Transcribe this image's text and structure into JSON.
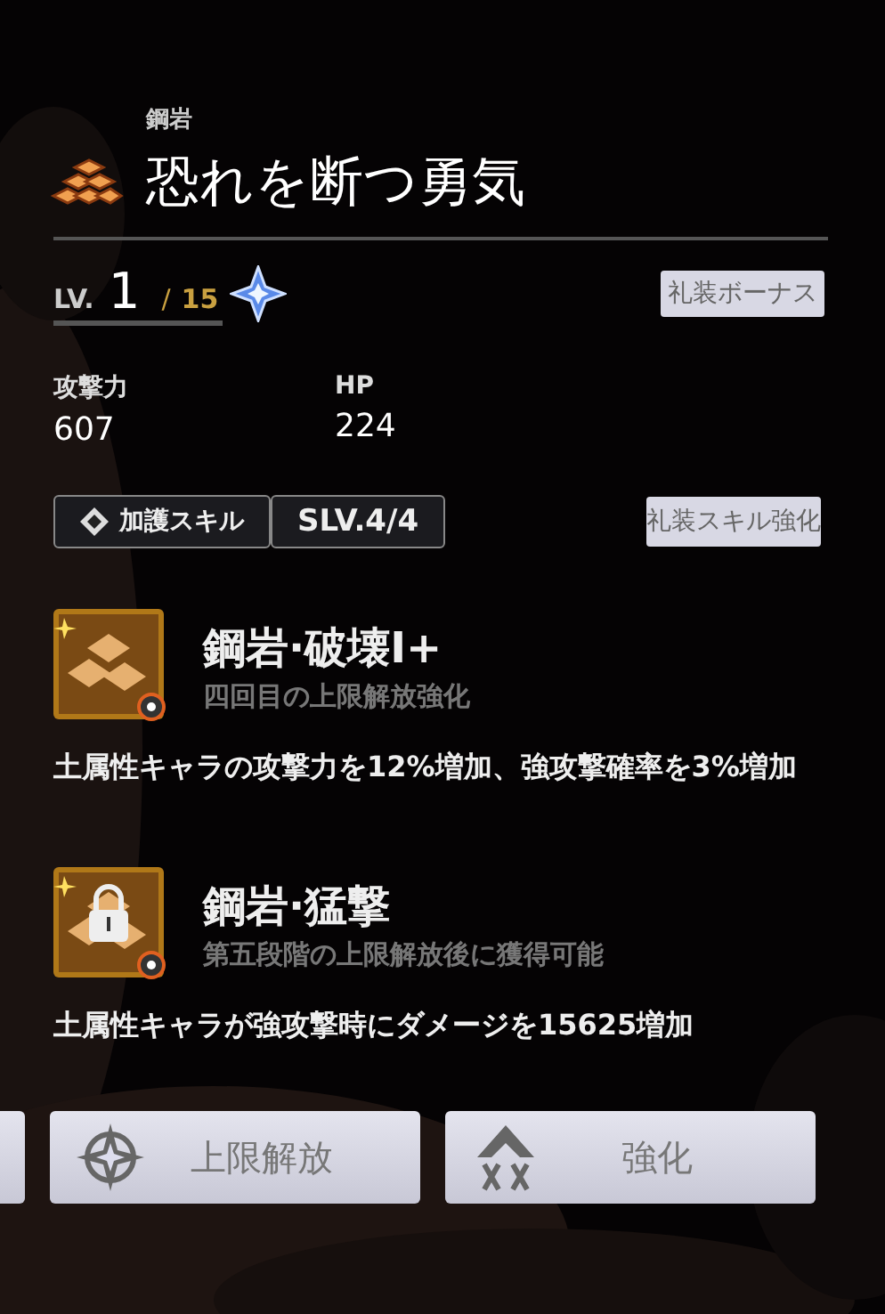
{
  "element": "鋼岩",
  "title": "恐れを断つ勇気",
  "level": {
    "label": "LV.",
    "current": "1",
    "separator": "/",
    "max": "15"
  },
  "bonus_button": "礼装ボーナス",
  "stats": [
    {
      "label": "攻撃力",
      "value": "607"
    },
    {
      "label": "HP",
      "value": "224"
    }
  ],
  "skill_tag": {
    "label": "加護スキル",
    "slv": "SLV.4/4"
  },
  "skill_upgrade_button": "礼装スキル強化",
  "skills": [
    {
      "name": "鋼岩·破壊Ⅰ+",
      "subtitle": "四回目の上限解放強化",
      "description": "土属性キャラの攻撃力を12%増加、強攻撃確率を3%増加",
      "locked": false
    },
    {
      "name": "鋼岩·猛撃",
      "subtitle": "第五段階の上限解放後に獲得可能",
      "description": "土属性キャラが強攻撃時にダメージを15625増加",
      "locked": true
    }
  ],
  "buttons": [
    {
      "kind": "ascend",
      "label": "上限解放"
    },
    {
      "kind": "enhance",
      "label": "強化"
    }
  ]
}
